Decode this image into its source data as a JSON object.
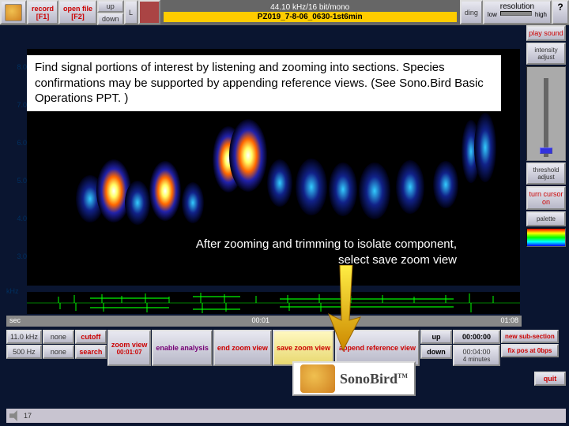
{
  "topbar": {
    "record": "record",
    "record_key": "[F1]",
    "open": "open file",
    "open_key": "[F2]",
    "up": "up",
    "down": "down",
    "lch": "L",
    "ding": "ding",
    "format": "44.10 kHz/16 bit/mono",
    "filename": "PZ019_7-8-06_0630-1st6min",
    "resolution": "resolution",
    "res_low": "low",
    "res_high": "high",
    "help": "?"
  },
  "rightcol": {
    "play": "play sound",
    "intensity": "intensity adjust",
    "threshold": "threshold adjust",
    "cursor": "turn cursor on",
    "palette": "palette"
  },
  "yaxis": {
    "vals": [
      "8.0",
      "7.0",
      "6.0",
      "5.0",
      "4.0",
      "3.0"
    ],
    "unit": "kHz"
  },
  "timebar": {
    "label": "sec",
    "t0": "00:01",
    "t1": "01:08"
  },
  "bottom": {
    "freq1": "11.0 kHz",
    "freq2": "500 Hz",
    "cutoff": "cutoff",
    "search": "search",
    "none": "none",
    "zoom_view": "zoom view",
    "zoom_val": "00:01:07",
    "enable": "enable analysis",
    "end": "end zoom view",
    "save": "save zoom view",
    "append": "append reference view",
    "up": "up",
    "down": "down",
    "timestamp": "00:00:00",
    "duration": "00:04:00",
    "dur_label": "4 minutes",
    "newsub": "new sub-section",
    "fixpos": "fix pos at 0bps",
    "quit": "quit"
  },
  "logo": {
    "name": "SonoBird",
    "tm": "TM"
  },
  "footer": {
    "slide": "17"
  },
  "overlay": {
    "box1": "Find signal portions of interest by listening and zooming into sections. Species confirmations may be supported by appending reference views. (See Sono.Bird Basic Operations PPT. )",
    "box2a": "After zooming and trimming to isolate component,",
    "box2b": "select save zoom view"
  },
  "chart_data": {
    "type": "spectrogram",
    "title": "",
    "xlabel": "sec",
    "ylabel": "kHz",
    "xlim": [
      "00:01",
      "01:08"
    ],
    "ylim": [
      3.0,
      8.0
    ],
    "note": "Bird vocalization spectrogram with intensity blobs concentrated 4-7 kHz; ~12 distinct call bursts across timeline; green waveform amplitude track below."
  }
}
